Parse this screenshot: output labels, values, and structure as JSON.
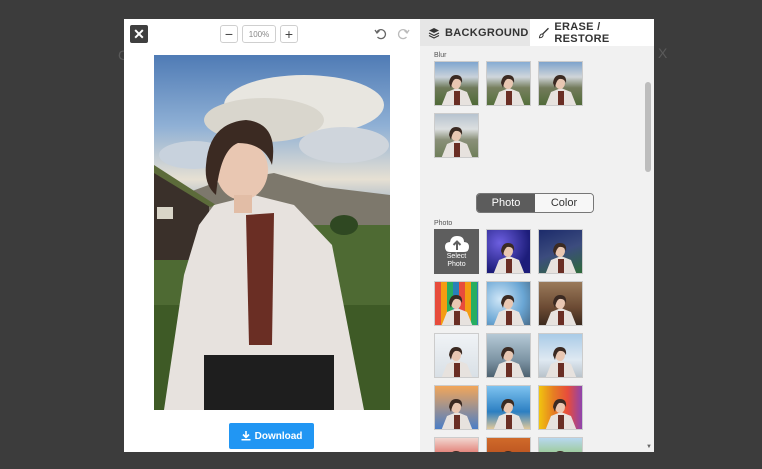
{
  "backdrop": {
    "left_letter": "C",
    "right_letter": "X"
  },
  "toolbar": {
    "close_glyph": "✕",
    "zoom_out": "−",
    "zoom_in": "+",
    "zoom_level": "100%"
  },
  "download": {
    "label": "Download"
  },
  "tabs": {
    "background": "BACKGROUND",
    "erase_restore": "ERASE / RESTORE"
  },
  "sections": {
    "blur": "Blur",
    "photo": "Photo"
  },
  "mode_toggle": {
    "photo": "Photo",
    "color": "Color",
    "selected": "Photo"
  },
  "select_photo": {
    "line1": "Select",
    "line2": "Photo"
  },
  "blur_thumbs": [
    "blur-1",
    "blur-2",
    "blur-3",
    "blur-4"
  ],
  "photo_thumbs": [
    "starry-blue",
    "starry-green",
    "rainbow-stripes",
    "bokeh-lights",
    "canyon",
    "whiteboard",
    "city-skyline",
    "clock-tower",
    "orange-sky",
    "ocean",
    "rainbow-gradient",
    "red-flowers",
    "autumn-trees",
    "green-hills"
  ],
  "colors": {
    "accent": "#2196f3",
    "panel": "#f1f1f1",
    "dark_tab": "#5c5c5c"
  },
  "icons": {
    "download": "download-icon",
    "background_tab": "layers-icon",
    "erase_tab": "brush-icon",
    "upload": "cloud-upload-icon",
    "undo": "undo-icon",
    "redo": "redo-icon"
  }
}
